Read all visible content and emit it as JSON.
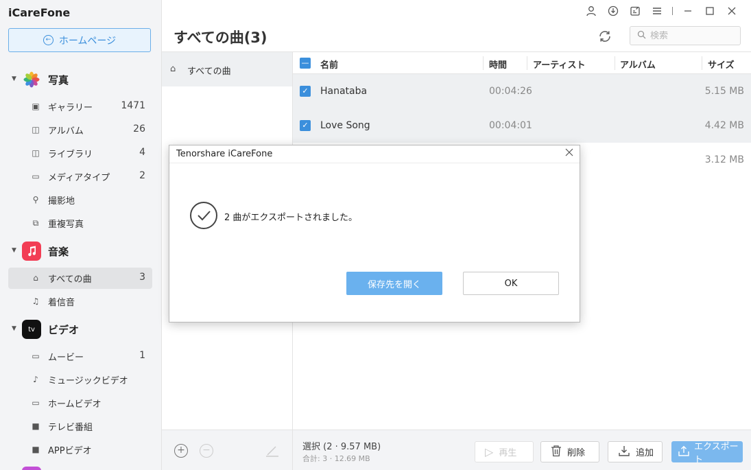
{
  "app": {
    "title": "iCareFone"
  },
  "home_button": {
    "label": "ホームページ"
  },
  "sidebar": {
    "sections": [
      {
        "label": "写真",
        "icon": "photos-app-icon"
      },
      {
        "label": "音楽",
        "icon": "music-app-icon"
      },
      {
        "label": "ビデオ",
        "icon": "appletv-app-icon",
        "icon_text": "tv"
      }
    ],
    "photos_items": [
      {
        "label": "ギャラリー",
        "count": "1471"
      },
      {
        "label": "アルバム",
        "count": "26"
      },
      {
        "label": "ライブラリ",
        "count": "4"
      },
      {
        "label": "メディアタイプ",
        "count": "2"
      },
      {
        "label": "撮影地",
        "count": ""
      },
      {
        "label": "重複写真",
        "count": ""
      }
    ],
    "music_items": [
      {
        "label": "すべての曲",
        "count": "3"
      },
      {
        "label": "着信音",
        "count": ""
      }
    ],
    "video_items": [
      {
        "label": "ムービー",
        "count": "1"
      },
      {
        "label": "ミュージックビデオ",
        "count": ""
      },
      {
        "label": "ホームビデオ",
        "count": ""
      },
      {
        "label": "テレビ番組",
        "count": ""
      },
      {
        "label": "APPビデオ",
        "count": ""
      }
    ]
  },
  "header": {
    "title": "すべての曲(3)",
    "search_placeholder": "検索"
  },
  "middle": {
    "item_label": "すべての曲"
  },
  "table": {
    "columns": [
      "名前",
      "時間",
      "アーティスト",
      "アルバム",
      "サイズ"
    ],
    "rows": [
      {
        "name": "Hanataba",
        "time": "00:04:26",
        "artist": "",
        "album": "",
        "size": "5.15 MB",
        "checked": true
      },
      {
        "name": "Love Song",
        "time": "00:04:01",
        "artist": "",
        "album": "",
        "size": "4.42 MB",
        "checked": true
      },
      {
        "name": "",
        "time": "",
        "artist": "",
        "album": "",
        "size": "3.12 MB",
        "checked": false
      }
    ]
  },
  "footer": {
    "selection": "選択 (2 · 9.57 MB)",
    "total": "合計: 3 · 12.69 MB",
    "play_label": "再生",
    "delete_label": "削除",
    "add_label": "追加",
    "export_label": "エクスポート"
  },
  "dialog": {
    "title": "Tenorshare iCareFone",
    "message": "2 曲がエクスポートされました。",
    "open_button": "保存先を開く",
    "ok_button": "OK"
  },
  "colors": {
    "accent": "#3b8fdc",
    "sidebar_bg": "#f3f4f6",
    "row_selected": "#eef0f2",
    "dialog_primary": "#6ab1ee"
  }
}
